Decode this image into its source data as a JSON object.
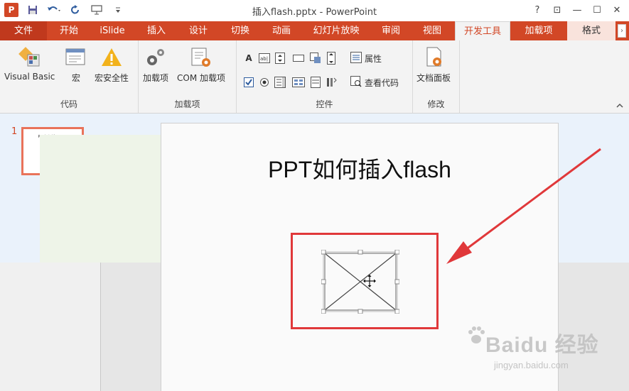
{
  "titlebar": {
    "title": "插入flash.pptx - PowerPoint",
    "app_icon": "P",
    "help": "?",
    "restore_ribbon": "⊡",
    "minimize": "—",
    "maximize": "☐",
    "close": "✕"
  },
  "tabs": [
    {
      "label": "文件"
    },
    {
      "label": "开始"
    },
    {
      "label": "iSlide"
    },
    {
      "label": "插入"
    },
    {
      "label": "设计"
    },
    {
      "label": "切换"
    },
    {
      "label": "动画"
    },
    {
      "label": "幻灯片放映"
    },
    {
      "label": "审阅"
    },
    {
      "label": "视图"
    },
    {
      "label": "开发工具"
    },
    {
      "label": "加载项"
    },
    {
      "label": "格式"
    }
  ],
  "ribbon": {
    "groups": {
      "code": {
        "label": "代码",
        "visual_basic": "Visual Basic",
        "macro": "宏",
        "macro_security": "宏安全性"
      },
      "addins": {
        "label": "加载项",
        "addins_btn": "加载项",
        "com_addins": "COM 加载项"
      },
      "controls": {
        "label": "控件",
        "properties": "属性",
        "view_code": "查看代码"
      },
      "modify": {
        "label": "修改",
        "doc_panel": "文档面板"
      }
    }
  },
  "thumbnails": [
    {
      "number": "1",
      "title": "PPT如何插入flash"
    }
  ],
  "slide": {
    "title": "PPT如何插入flash"
  },
  "watermark": {
    "brand": "Baidu 经验",
    "url": "jingyan.baidu.com"
  },
  "colors": {
    "accent": "#d24726",
    "highlight_box": "#e0383a",
    "arrow": "#e0383a"
  }
}
